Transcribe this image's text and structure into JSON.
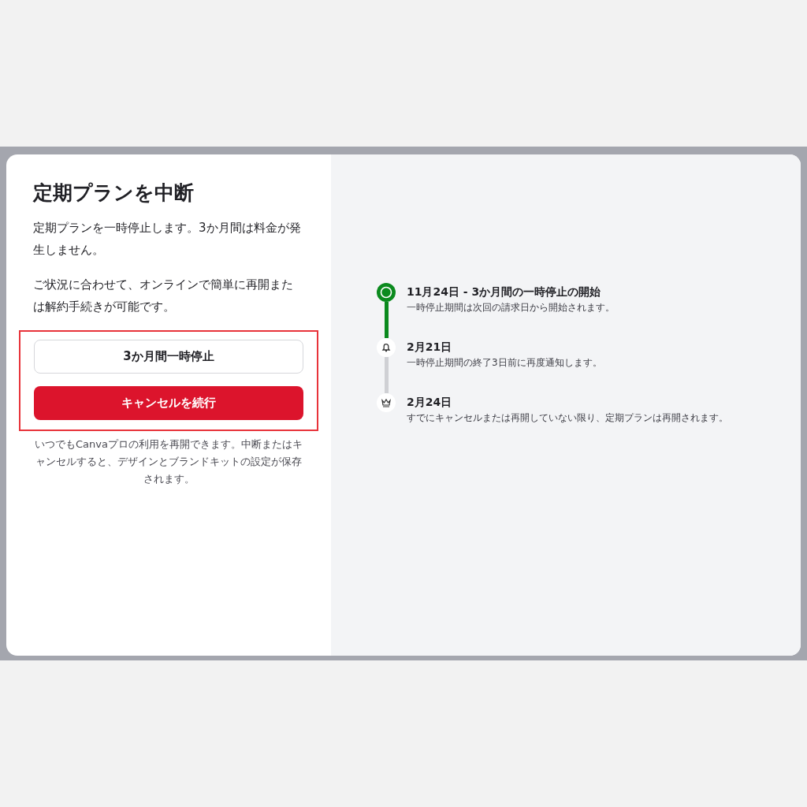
{
  "dialog": {
    "title": "定期プランを中断",
    "paragraphs": [
      "定期プランを一時停止します。3か月間は料金が発生しません。",
      "ご状況に合わせて、オンラインで簡単に再開または解約手続きが可能です。"
    ],
    "actions": {
      "highlighted": true,
      "buttons": [
        {
          "label": "3か月間一時停止",
          "kind": "secondary"
        },
        {
          "label": "キャンセルを続行",
          "kind": "primary"
        }
      ]
    },
    "footnote": "いつでもCanvaプロの利用を再開できます。中断またはキャンセルすると、デザインとブランドキットの設定が保存されます。",
    "timeline": [
      {
        "kind": "start",
        "title": "11月24日 - 3か月間の一時停止の開始",
        "description": "一時停止期間は次回の請求日から開始されます。"
      },
      {
        "kind": "bell",
        "title": "2月21日",
        "description": "一時停止期間の終了3日前に再度通知します。"
      },
      {
        "kind": "crown",
        "title": "2月24日",
        "description": "すでにキャンセルまたは再開していない限り、定期プランは再開されます。"
      }
    ]
  }
}
